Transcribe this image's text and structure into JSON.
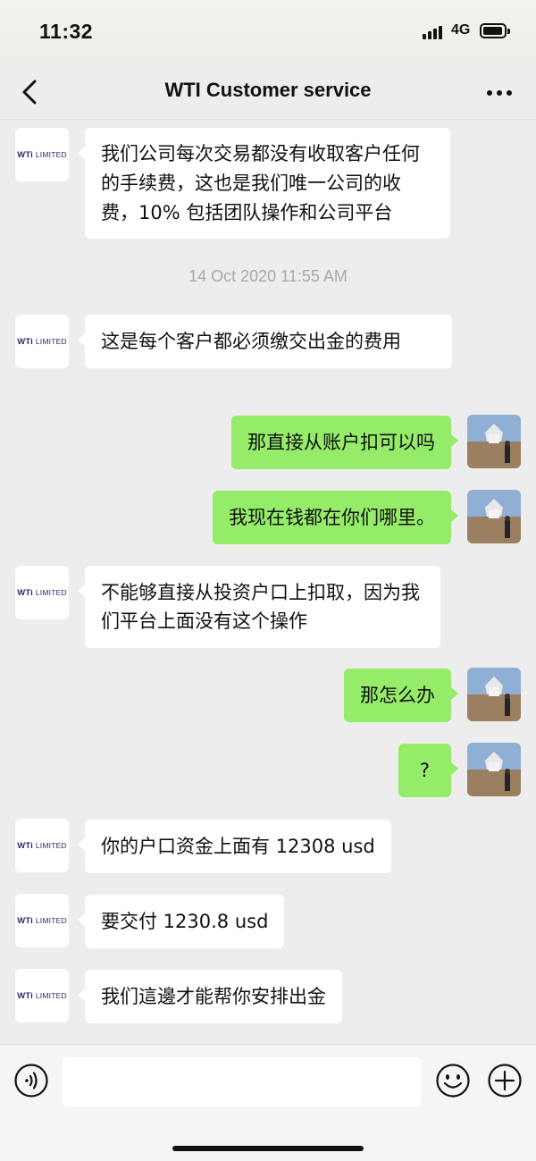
{
  "status_bar": {
    "time": "11:32",
    "network": "4G"
  },
  "header": {
    "title": "WTI Customer service"
  },
  "avatar_logo": {
    "brand": "WTi",
    "suffix": "LIMITED"
  },
  "messages": [
    {
      "side": "left",
      "text": "我们公司每次交易都没有收取客户任何的手续费，这也是我们唯一公司的收费，10% 包括团队操作和公司平台"
    },
    {
      "timestamp": "14 Oct 2020 11:55 AM"
    },
    {
      "side": "left",
      "text": "这是每个客户都必须缴交出金的费用"
    },
    {
      "side": "right",
      "text": "那直接从账户扣可以吗"
    },
    {
      "side": "right",
      "text": "我现在钱都在你们哪里。"
    },
    {
      "side": "left",
      "text": "不能够直接从投资户口上扣取，因为我们平台上面没有这个操作"
    },
    {
      "side": "right",
      "text": "那怎么办"
    },
    {
      "side": "right",
      "text": "?"
    },
    {
      "side": "left",
      "text": "你的户口资金上面有 12308 usd"
    },
    {
      "side": "left",
      "text": "要交付 1230.8 usd"
    },
    {
      "side": "left",
      "text": "我们這邊才能帮你安排出金"
    }
  ],
  "input": {
    "value": "",
    "placeholder": ""
  },
  "colors": {
    "outgoing_bubble": "#95ec69",
    "incoming_bubble": "#ffffff",
    "background": "#ededed"
  },
  "icons": {
    "back": "chevron-left-icon",
    "more": "more-dots-icon",
    "voice": "voice-icon",
    "emoji": "emoji-icon",
    "plus": "plus-icon"
  }
}
